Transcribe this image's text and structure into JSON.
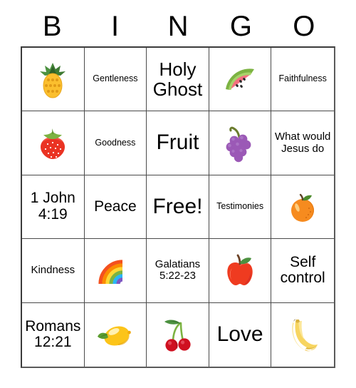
{
  "card": {
    "title_letters": [
      "B",
      "I",
      "N",
      "G",
      "O"
    ],
    "columns": 5,
    "rows": 5,
    "border_color": "#4a4a4a",
    "background": "#ffffff",
    "text_color": "#000000",
    "cells": [
      {
        "id": "b1",
        "type": "emoji",
        "icon": "pineapple-emoji",
        "label": ""
      },
      {
        "id": "i1",
        "type": "text",
        "icon": "",
        "label": "Gentleness",
        "size": "xs"
      },
      {
        "id": "n1",
        "type": "text",
        "icon": "",
        "label": "Holy Ghost",
        "size": "lg"
      },
      {
        "id": "g1",
        "type": "emoji",
        "icon": "watermelon-emoji",
        "label": ""
      },
      {
        "id": "o1",
        "type": "text",
        "icon": "",
        "label": "Faithfulness",
        "size": "xs"
      },
      {
        "id": "b2",
        "type": "emoji",
        "icon": "strawberry-emoji",
        "label": ""
      },
      {
        "id": "i2",
        "type": "text",
        "icon": "",
        "label": "Goodness",
        "size": "xs"
      },
      {
        "id": "n2",
        "type": "text",
        "icon": "",
        "label": "Fruit",
        "size": "xl"
      },
      {
        "id": "g2",
        "type": "emoji",
        "icon": "grapes-emoji",
        "label": ""
      },
      {
        "id": "o2",
        "type": "text",
        "icon": "",
        "label": "What would Jesus do",
        "size": "sm"
      },
      {
        "id": "b3",
        "type": "text",
        "icon": "",
        "label": "1 John 4:19",
        "size": "md"
      },
      {
        "id": "i3",
        "type": "text",
        "icon": "",
        "label": "Peace",
        "size": "md"
      },
      {
        "id": "n3",
        "type": "text",
        "icon": "",
        "label": "Free!",
        "size": "xl"
      },
      {
        "id": "g3",
        "type": "text",
        "icon": "",
        "label": "Testimonies",
        "size": "xs"
      },
      {
        "id": "o3",
        "type": "emoji",
        "icon": "tangerine-emoji",
        "label": ""
      },
      {
        "id": "b4",
        "type": "text",
        "icon": "",
        "label": "Kindness",
        "size": "sm"
      },
      {
        "id": "i4",
        "type": "emoji",
        "icon": "rainbow-emoji",
        "label": ""
      },
      {
        "id": "n4",
        "type": "text",
        "icon": "",
        "label": "Galatians 5:22-23",
        "size": "sm"
      },
      {
        "id": "g4",
        "type": "emoji",
        "icon": "red-apple-emoji",
        "label": ""
      },
      {
        "id": "o4",
        "type": "text",
        "icon": "",
        "label": "Self control",
        "size": "md"
      },
      {
        "id": "b5",
        "type": "text",
        "icon": "",
        "label": "Romans 12:21",
        "size": "md"
      },
      {
        "id": "i5",
        "type": "emoji",
        "icon": "lemon-emoji",
        "label": ""
      },
      {
        "id": "n5",
        "type": "emoji",
        "icon": "cherries-emoji",
        "label": ""
      },
      {
        "id": "g5",
        "type": "text",
        "icon": "",
        "label": "Love",
        "size": "xl"
      },
      {
        "id": "o5",
        "type": "emoji",
        "icon": "banana-emoji",
        "label": ""
      }
    ]
  }
}
